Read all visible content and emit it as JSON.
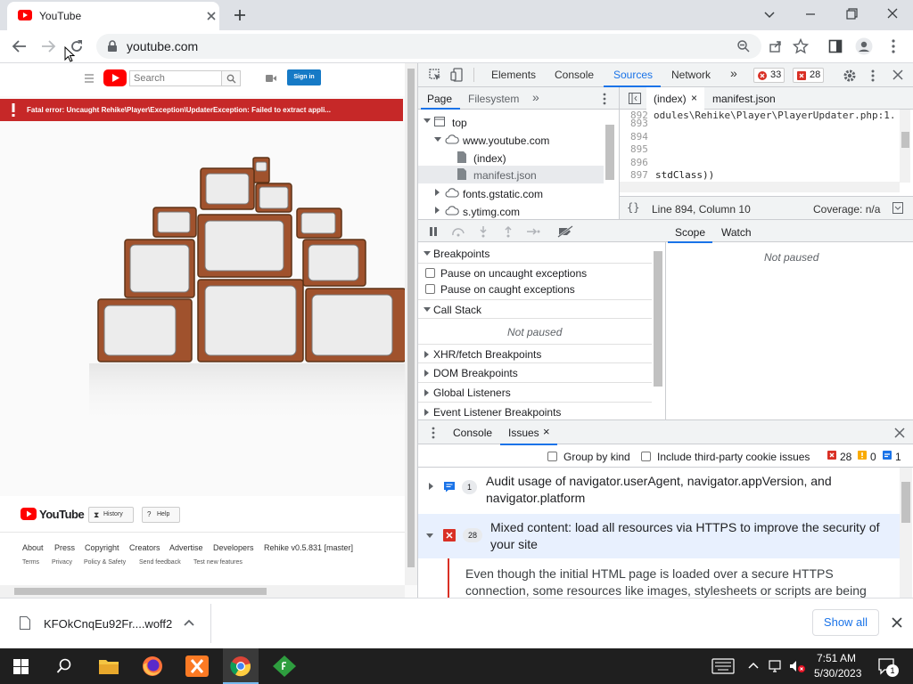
{
  "browser": {
    "tab_title": "YouTube",
    "url": "youtube.com"
  },
  "page": {
    "search_placeholder": "Search",
    "sign_in": "Sign in",
    "error_banner": "Fatal error: Uncaught Rehike\\Player\\Exception\\UpdaterException: Failed to extract appli...",
    "footer": {
      "logo": "YouTube",
      "history_button": "History",
      "help_button": "Help",
      "links": [
        "About",
        "Press",
        "Copyright",
        "Creators",
        "Advertise",
        "Developers",
        "Rehike v0.5.831 [master]"
      ],
      "sublinks": [
        "Terms",
        "Privacy",
        "Policy & Safety",
        "Send feedback",
        "Test new features"
      ]
    }
  },
  "devtools": {
    "tabs": [
      "Elements",
      "Console",
      "Sources",
      "Network"
    ],
    "active_tab": "Sources",
    "error_count": "33",
    "issue_count": "28",
    "navigator_tabs": [
      "Page",
      "Filesystem"
    ],
    "file_tree": {
      "top": "top",
      "domain": "www.youtube.com",
      "files": [
        "(index)",
        "manifest.json"
      ],
      "other_domains": [
        "fonts.gstatic.com",
        "s.ytimg.com"
      ]
    },
    "editor_tabs": [
      "(index)",
      "manifest.json"
    ],
    "code_lines": [
      {
        "num": "893",
        "text": ""
      },
      {
        "num": "894",
        "text": ""
      },
      {
        "num": "895",
        "text": ""
      },
      {
        "num": "896",
        "text": ""
      },
      {
        "num": "897",
        "text": "stdClass))"
      }
    ],
    "code_top_line": "odules\\Rehike\\Player\\PlayerUpdater.php:1.",
    "status_line": "Line 894, Column 10",
    "coverage": "Coverage: n/a",
    "scope_tab": "Scope",
    "watch_tab": "Watch",
    "not_paused": "Not paused",
    "breakpoints": {
      "title": "Breakpoints",
      "pause_uncaught": "Pause on uncaught exceptions",
      "pause_caught": "Pause on caught exceptions"
    },
    "call_stack": "Call Stack",
    "call_stack_status": "Not paused",
    "sections": [
      "XHR/fetch Breakpoints",
      "DOM Breakpoints",
      "Global Listeners",
      "Event Listener Breakpoints"
    ],
    "drawer_tabs": [
      "Console",
      "Issues"
    ],
    "group_by_kind": "Group by kind",
    "include_third_party": "Include third-party cookie issues",
    "issue_counts": {
      "errors": "28",
      "warnings": "0",
      "info": "1"
    },
    "issues": [
      {
        "count": "1",
        "text": "Audit usage of navigator.userAgent, navigator.appVersion, and navigator.platform"
      },
      {
        "count": "28",
        "text": "Mixed content: load all resources via HTTPS to improve the security of your site"
      }
    ],
    "issue_detail": "Even though the initial HTML page is loaded over a secure HTTPS connection, some resources like images, stylesheets or scripts are being"
  },
  "downloads": {
    "file": "KFOkCnqEu92Fr....woff2",
    "show_all": "Show all"
  },
  "taskbar": {
    "time": "7:51 AM",
    "date": "5/30/2023",
    "notifications": "1"
  },
  "colors": {
    "youtube_red": "#ff0000",
    "error_red": "#c62828",
    "devtools_blue": "#1a73e8",
    "taskbar": "#1f1f1f"
  }
}
